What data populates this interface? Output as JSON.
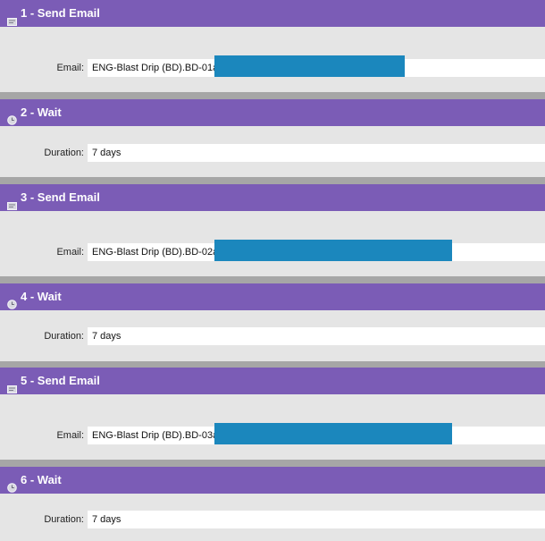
{
  "colors": {
    "header_bg": "#7b5cb6",
    "body_bg": "#e5e5e5",
    "separator": "#a6a6a6",
    "redaction": "#1b87bd"
  },
  "steps": [
    {
      "title": "1 - Send Email",
      "icon": "email-icon",
      "label": "Email:",
      "value": "ENG-Blast Drip (BD).BD-01a"
    },
    {
      "title": "2 - Wait",
      "icon": "clock-icon",
      "label": "Duration:",
      "value": "7 days"
    },
    {
      "title": "3 - Send Email",
      "icon": "email-icon",
      "label": "Email:",
      "value": "ENG-Blast Drip (BD).BD-02a"
    },
    {
      "title": "4 - Wait",
      "icon": "clock-icon",
      "label": "Duration:",
      "value": "7 days"
    },
    {
      "title": "5 - Send Email",
      "icon": "email-icon",
      "label": "Email:",
      "value": "ENG-Blast Drip (BD).BD-03a"
    },
    {
      "title": "6 - Wait",
      "icon": "clock-icon",
      "label": "Duration:",
      "value": "7 days"
    }
  ]
}
